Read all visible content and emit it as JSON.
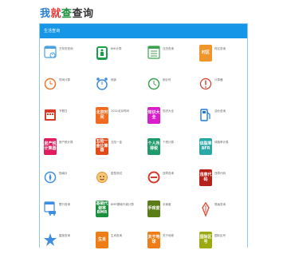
{
  "site": {
    "logo": [
      "我",
      "就",
      "查",
      "查询"
    ]
  },
  "panel": {
    "title": "生活查询"
  },
  "tools": [
    [
      {
        "icon": "calendar-icon",
        "label": "万年历查询"
      },
      {
        "icon": "bmi-icon",
        "label": "BMI计算"
      },
      {
        "icon": "list-calendar-icon",
        "label": "日历查询"
      },
      {
        "icon": "timezone-badge-icon",
        "badge": "时区",
        "color": "#f0952a",
        "label": "时区查询"
      }
    ],
    [
      {
        "icon": "clock-icon",
        "label": "时间计算"
      },
      {
        "icon": "alarm-clock-icon",
        "label": "闹钟"
      },
      {
        "icon": "green-clock-icon",
        "label": "倒计时"
      },
      {
        "icon": "exclamation-icon",
        "label": "计算器"
      }
    ],
    [
      {
        "icon": "red-calendar-icon",
        "label": "节假日"
      },
      {
        "icon": "beijing-time-icon",
        "badge": "北京时间",
        "color": "#f06a20",
        "label": "2022北京时间"
      },
      {
        "icon": "knowledge-icon",
        "badge": "知识大全",
        "color": "#d81ec8",
        "label": "知识大全"
      },
      {
        "icon": "fuel-icon",
        "label": "油价查询"
      }
    ],
    [
      {
        "icon": "housing-fund-icon",
        "badge": "房产税计算器",
        "color": "#e01c5e",
        "label": "房产税计算"
      },
      {
        "icon": "tax-calc-icon",
        "badge": "五险一金计算器",
        "color": "#e34a1a",
        "label": "五险一金"
      },
      {
        "icon": "income-tax-icon",
        "badge": "个人所得税",
        "color": "#1f9a6a",
        "label": "个税计算"
      },
      {
        "icon": "bfr-icon",
        "badge": "体脂率BFR",
        "color": "#2aa8a8",
        "label": "体脂率计算"
      }
    ],
    [
      {
        "icon": "compass-icon",
        "label": "指南针"
      },
      {
        "icon": "face-icon",
        "label": "脸型测试"
      },
      {
        "icon": "no-entry-icon",
        "label": "违章查询"
      },
      {
        "icon": "violation-code-icon",
        "badge": "违章代码",
        "color": "#b5221a",
        "label": "违章代码"
      }
    ],
    [
      {
        "icon": "calendar-car-icon",
        "label": "限行查询"
      },
      {
        "icon": "bmr-icon",
        "badge": "基础代谢率BMR",
        "color": "#1a8f3c",
        "label": "BMR基础代谢计算"
      },
      {
        "icon": "handwriting-icon",
        "badge": "手痒度",
        "color": "#5a7d18",
        "label": "手痒度"
      },
      {
        "icon": "pen-icon",
        "label": "笔画查询"
      }
    ],
    [
      {
        "icon": "star-icon",
        "label": "星座查询"
      },
      {
        "icon": "zodiac-icon",
        "badge": "生肖",
        "color": "#ef7d17",
        "label": "生肖查询"
      },
      {
        "icon": "about-icon",
        "badge": "关于地球",
        "color": "#ef7d17",
        "label": "关于地球"
      },
      {
        "icon": "area-code-icon",
        "badge": "国际区号",
        "color": "#9aaa10",
        "label": "国际区号"
      }
    ]
  ]
}
